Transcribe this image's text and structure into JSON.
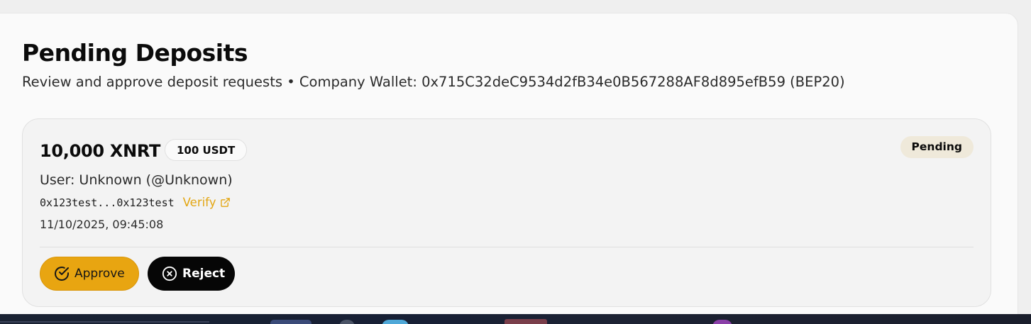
{
  "header": {
    "title": "Pending Deposits",
    "subtitle": "Review and approve deposit requests • Company Wallet: 0x715C32deC9534d2fB34e0B567288AF8d895efB59 (BEP20)"
  },
  "deposit": {
    "amount": "10,000 XNRT",
    "usdt_amount": "100 USDT",
    "status": "Pending",
    "user": "User: Unknown (@Unknown)",
    "tx_hash": "0x123test...0x123test",
    "verify_label": "Verify",
    "verify_icon": "external-link-icon",
    "timestamp": "11/10/2025, 09:45:08",
    "approve_label": "Approve",
    "approve_icon": "check-circle-icon",
    "reject_label": "Reject",
    "reject_icon": "x-circle-icon"
  },
  "colors": {
    "accent": "#E8A511",
    "status_badge_bg": "#EFE9DA",
    "reject_bg": "#060606",
    "link": "#E3A612"
  }
}
